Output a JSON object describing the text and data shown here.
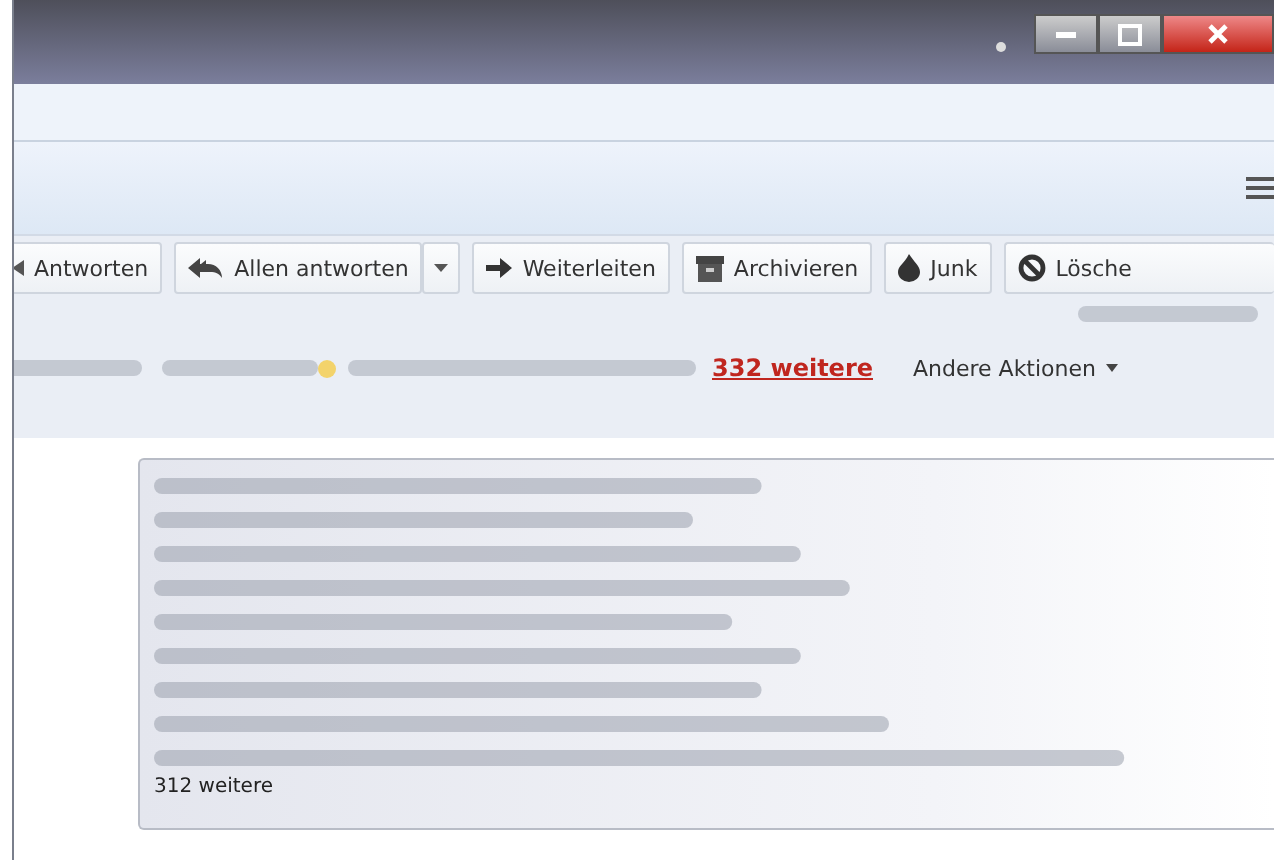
{
  "toolbar_buttons": [
    {
      "label": "Antworten",
      "kind": "reply"
    },
    {
      "label": "Allen antworten",
      "kind": "reply-all"
    },
    {
      "label": "Weiterleiten",
      "kind": "forward"
    },
    {
      "label": "Archivieren",
      "kind": "archive"
    },
    {
      "label": "Junk",
      "kind": "junk"
    },
    {
      "label": "Lösche",
      "kind": "delete"
    }
  ],
  "recipients_more_link": "332 weitere",
  "other_actions": "Andere Aktionen",
  "recipients_box_more": "312 weitere"
}
